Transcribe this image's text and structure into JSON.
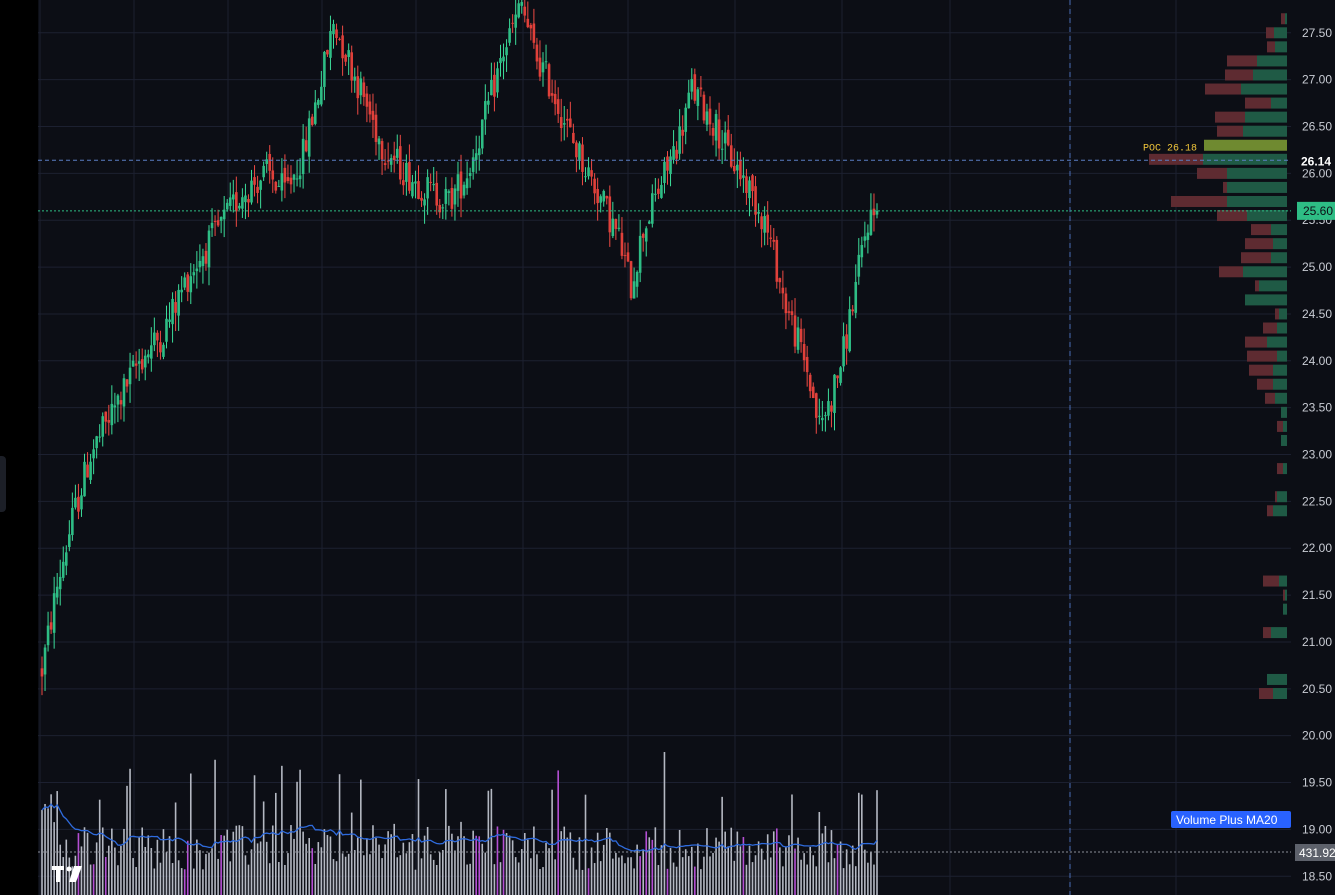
{
  "chart_data": {
    "type": "candlestick",
    "symbol": "",
    "y_ticks": [
      18.5,
      19.0,
      19.5,
      20.0,
      20.5,
      21.0,
      21.5,
      22.0,
      22.5,
      23.0,
      23.5,
      24.0,
      24.5,
      25.0,
      25.5,
      26.0,
      26.5,
      27.0,
      27.5
    ],
    "y_tick_labels": [
      "18.50",
      "19.00",
      "19.50",
      "20.00",
      "20.50",
      "21.00",
      "21.50",
      "22.00",
      "22.50",
      "23.00",
      "23.50",
      "24.00",
      "24.50",
      "25.00",
      "25.50",
      "26.00",
      "26.50",
      "27.00",
      "27.50"
    ],
    "ylim": [
      18.3,
      27.85
    ],
    "path_points": [
      [
        0,
        20.7
      ],
      [
        5,
        21.6
      ],
      [
        10,
        22.3
      ],
      [
        16,
        23.0
      ],
      [
        24,
        23.5
      ],
      [
        32,
        24.0
      ],
      [
        40,
        24.3
      ],
      [
        48,
        24.9
      ],
      [
        58,
        25.4
      ],
      [
        66,
        25.8
      ],
      [
        74,
        26.0
      ],
      [
        80,
        25.8
      ],
      [
        86,
        26.2
      ],
      [
        92,
        27.0
      ],
      [
        96,
        27.6
      ],
      [
        100,
        27.3
      ],
      [
        106,
        26.8
      ],
      [
        112,
        26.3
      ],
      [
        120,
        26.0
      ],
      [
        128,
        25.8
      ],
      [
        134,
        25.7
      ],
      [
        140,
        26.0
      ],
      [
        146,
        26.6
      ],
      [
        152,
        27.3
      ],
      [
        158,
        27.8
      ],
      [
        162,
        27.3
      ],
      [
        168,
        26.9
      ],
      [
        174,
        26.4
      ],
      [
        180,
        26.0
      ],
      [
        186,
        25.6
      ],
      [
        190,
        25.3
      ],
      [
        194,
        24.8
      ],
      [
        198,
        25.4
      ],
      [
        204,
        25.9
      ],
      [
        210,
        26.4
      ],
      [
        214,
        26.9
      ],
      [
        218,
        26.7
      ],
      [
        222,
        26.5
      ],
      [
        226,
        26.2
      ],
      [
        232,
        25.9
      ],
      [
        238,
        25.5
      ],
      [
        242,
        25.0
      ],
      [
        244,
        24.7
      ],
      [
        248,
        24.3
      ],
      [
        252,
        23.9
      ],
      [
        256,
        23.3
      ],
      [
        260,
        23.6
      ],
      [
        264,
        24.1
      ],
      [
        268,
        24.8
      ],
      [
        272,
        25.5
      ],
      [
        275,
        25.6
      ]
    ],
    "total_bars": 276,
    "last_price": 25.6,
    "last_price_label": "25.60",
    "poc_price": 26.14,
    "poc_price_label": "26.14",
    "poc_label": "POC 26.18",
    "volume_profile": [
      {
        "price": 27.65,
        "up": 2,
        "down": 4
      },
      {
        "price": 27.5,
        "up": 13,
        "down": 8
      },
      {
        "price": 27.35,
        "up": 12,
        "down": 8
      },
      {
        "price": 27.2,
        "up": 30,
        "down": 30
      },
      {
        "price": 27.05,
        "up": 34,
        "down": 28
      },
      {
        "price": 26.9,
        "up": 46,
        "down": 36
      },
      {
        "price": 26.75,
        "up": 16,
        "down": 26
      },
      {
        "price": 26.6,
        "up": 42,
        "down": 30
      },
      {
        "price": 26.45,
        "up": 44,
        "down": 26
      },
      {
        "price": 26.3,
        "up": 83,
        "down": 0
      },
      {
        "price": 26.15,
        "up": 84,
        "down": 54
      },
      {
        "price": 26.0,
        "up": 60,
        "down": 30
      },
      {
        "price": 25.85,
        "up": 60,
        "down": 4
      },
      {
        "price": 25.7,
        "up": 60,
        "down": 56
      },
      {
        "price": 25.55,
        "up": 40,
        "down": 30
      },
      {
        "price": 25.4,
        "up": 16,
        "down": 20
      },
      {
        "price": 25.25,
        "up": 14,
        "down": 28
      },
      {
        "price": 25.1,
        "up": 16,
        "down": 30
      },
      {
        "price": 24.95,
        "up": 44,
        "down": 24
      },
      {
        "price": 24.8,
        "up": 28,
        "down": 4
      },
      {
        "price": 24.65,
        "up": 42,
        "down": 0
      },
      {
        "price": 24.5,
        "up": 8,
        "down": 4
      },
      {
        "price": 24.35,
        "up": 10,
        "down": 14
      },
      {
        "price": 24.2,
        "up": 20,
        "down": 22
      },
      {
        "price": 24.05,
        "up": 10,
        "down": 30
      },
      {
        "price": 23.9,
        "up": 14,
        "down": 24
      },
      {
        "price": 23.75,
        "up": 14,
        "down": 16
      },
      {
        "price": 23.6,
        "up": 12,
        "down": 10
      },
      {
        "price": 23.45,
        "up": 6,
        "down": 0
      },
      {
        "price": 23.3,
        "up": 4,
        "down": 6
      },
      {
        "price": 23.15,
        "up": 6,
        "down": 0
      },
      {
        "price": 22.85,
        "up": 4,
        "down": 6
      },
      {
        "price": 22.55,
        "up": 10,
        "down": 2
      },
      {
        "price": 22.4,
        "up": 14,
        "down": 6
      },
      {
        "price": 21.65,
        "up": 8,
        "down": 16
      },
      {
        "price": 21.5,
        "up": 2,
        "down": 2
      },
      {
        "price": 21.35,
        "up": 4,
        "down": 0
      },
      {
        "price": 21.1,
        "up": 16,
        "down": 8
      },
      {
        "price": 20.6,
        "up": 20,
        "down": 0
      },
      {
        "price": 20.45,
        "up": 14,
        "down": 14
      }
    ],
    "volume_indicator_label": "Volume Plus MA20",
    "volume_value_label": "431.92",
    "colors": {
      "background": "#0c0e15",
      "up": "#2ebd85",
      "down": "#e0403a",
      "wick_up": "#3cdc9a",
      "wick_down": "#ee4a44",
      "grid": "#1c2030",
      "volume_bar": "#b4b8c2",
      "volume_spike": "#b44fd3",
      "ma_line": "#2f6bdd",
      "poc_line": "#5b7fc4",
      "last_price_line": "#2ebd85",
      "crosshair": "#4a6fb8",
      "poc_label": "#f0c53a",
      "profile_up": "#1f5a45",
      "profile_down": "#5e2b31",
      "profile_poc": "#6f8a30"
    }
  }
}
